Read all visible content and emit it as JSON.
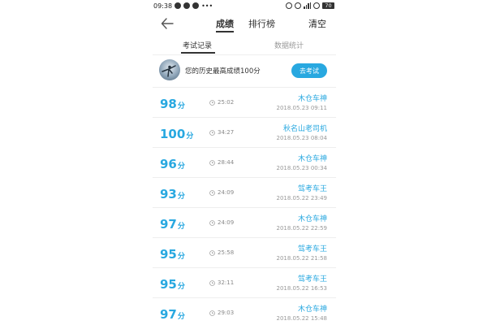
{
  "status_bar": {
    "time": "09:38",
    "battery": "70"
  },
  "header": {
    "tabs": [
      "成绩",
      "排行榜"
    ],
    "clear_label": "清空"
  },
  "subtabs": [
    "考试记录",
    "数据统计"
  ],
  "best": {
    "text": "您的历史最高成绩100分",
    "button_label": "去考试"
  },
  "records": [
    {
      "score": "98",
      "unit": "分",
      "duration": "25:02",
      "name": "木仓车神",
      "date": "2018.05.23  09:11"
    },
    {
      "score": "100",
      "unit": "分",
      "duration": "34:27",
      "name": "秋名山老司机",
      "date": "2018.05.23  08:04"
    },
    {
      "score": "96",
      "unit": "分",
      "duration": "28:44",
      "name": "木仓车神",
      "date": "2018.05.23  00:34"
    },
    {
      "score": "93",
      "unit": "分",
      "duration": "24:09",
      "name": "驾考车王",
      "date": "2018.05.22  23:49"
    },
    {
      "score": "97",
      "unit": "分",
      "duration": "24:09",
      "name": "木仓车神",
      "date": "2018.05.22  22:59"
    },
    {
      "score": "95",
      "unit": "分",
      "duration": "25:58",
      "name": "驾考车王",
      "date": "2018.05.22  21:58"
    },
    {
      "score": "95",
      "unit": "分",
      "duration": "32:11",
      "name": "驾考车王",
      "date": "2018.05.22  16:53"
    },
    {
      "score": "97",
      "unit": "分",
      "duration": "29:03",
      "name": "木仓车神",
      "date": "2018.05.22  15:48"
    }
  ],
  "colors": {
    "accent": "#28a8e0",
    "text": "#333333",
    "muted": "#999999",
    "divider": "#eeeeee"
  },
  "icons": {
    "back": "arrow-left-icon",
    "clock": "clock-icon"
  }
}
